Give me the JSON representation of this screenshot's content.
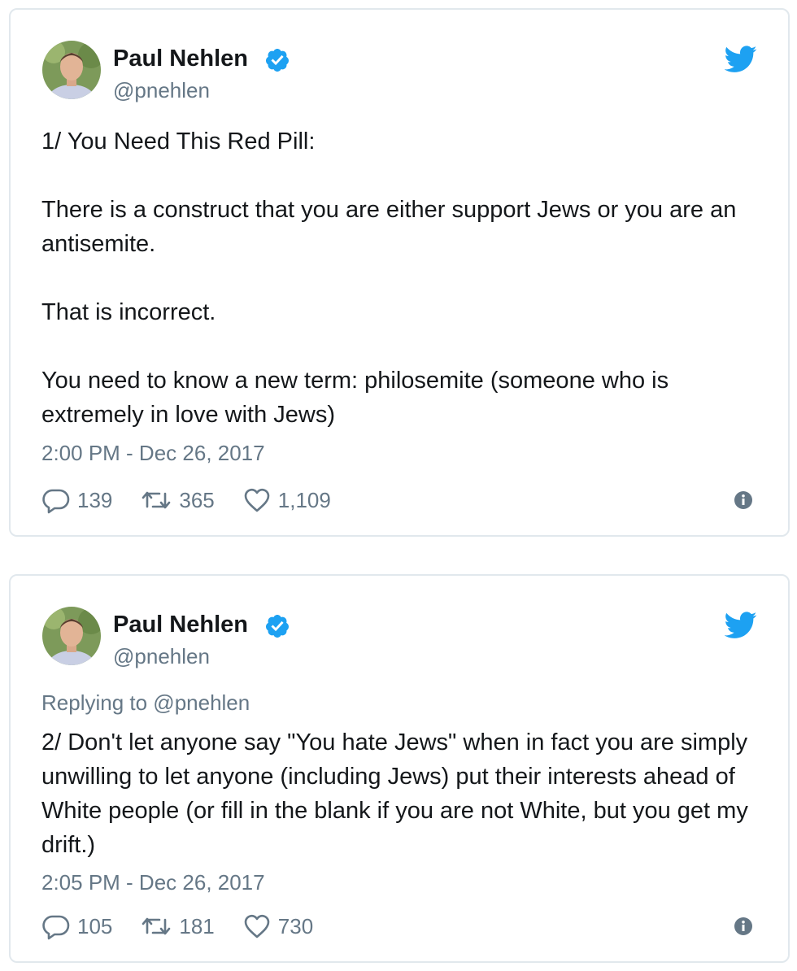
{
  "colors": {
    "twitter_blue": "#1da1f2",
    "text": "#14171a",
    "secondary_text": "#657786",
    "border": "#e1e8ed"
  },
  "tweets": [
    {
      "author": {
        "name": "Paul Nehlen",
        "handle": "@pnehlen",
        "verified": true
      },
      "reply_to": null,
      "text": "1/ You Need This Red Pill:\n\nThere is a construct that you are either support Jews or you are an antisemite.\n\nThat is incorrect.\n\nYou need to know a new term: philosemite (someone who is extremely in love with Jews)",
      "timestamp": "2:00 PM - Dec 26, 2017",
      "replies": "139",
      "retweets": "365",
      "likes": "1,109",
      "icons": [
        "reply-icon",
        "retweet-icon",
        "like-icon",
        "info-icon",
        "twitter-bird-icon",
        "verified-icon"
      ]
    },
    {
      "author": {
        "name": "Paul Nehlen",
        "handle": "@pnehlen",
        "verified": true
      },
      "reply_to": "Replying to @pnehlen",
      "text": "2/ Don't let anyone say \"You hate Jews\" when in fact you are simply unwilling to let anyone (including Jews) put their interests ahead of White people (or fill in the blank if you are not White, but you get my drift.)",
      "timestamp": "2:05 PM - Dec 26, 2017",
      "replies": "105",
      "retweets": "181",
      "likes": "730",
      "icons": [
        "reply-icon",
        "retweet-icon",
        "like-icon",
        "info-icon",
        "twitter-bird-icon",
        "verified-icon"
      ]
    }
  ]
}
